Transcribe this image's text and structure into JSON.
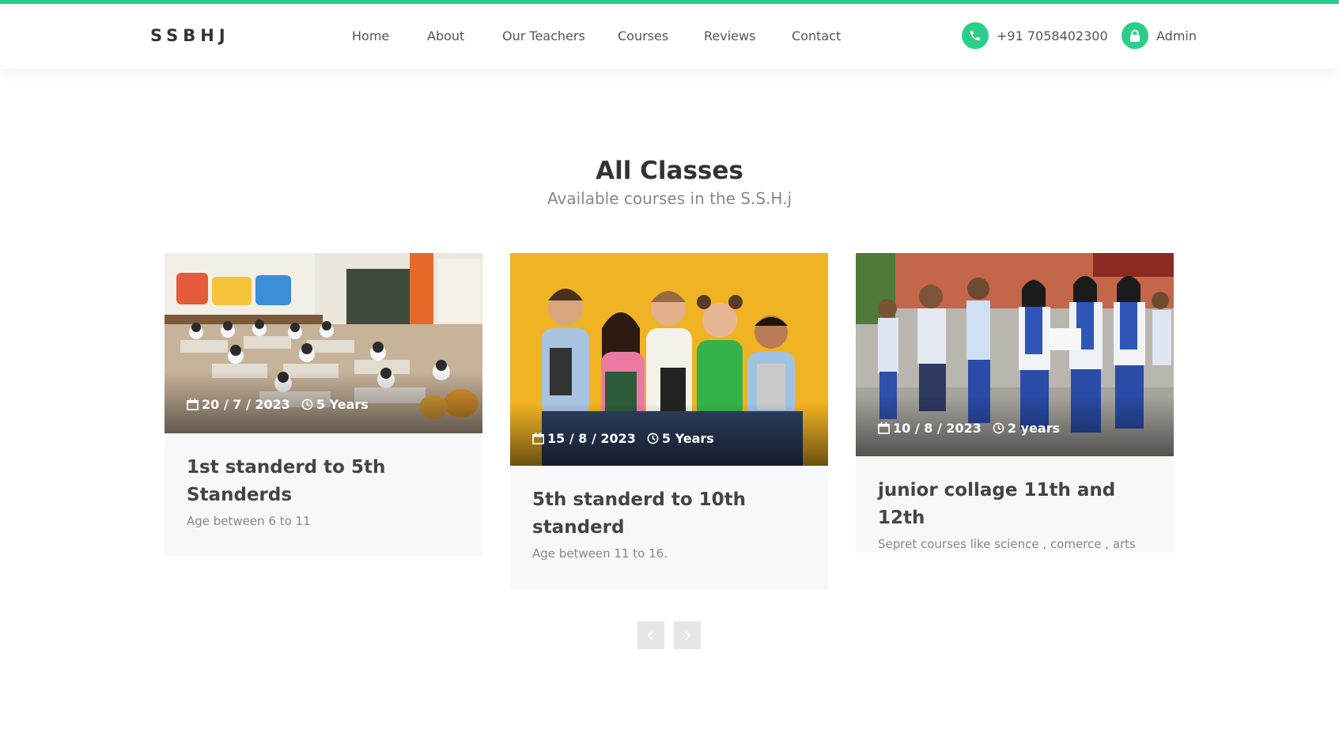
{
  "brand": "SSBHJ",
  "nav": {
    "items": [
      {
        "label": "Home"
      },
      {
        "label": "About"
      },
      {
        "label": "Our Teachers"
      },
      {
        "label": "Courses"
      },
      {
        "label": "Reviews"
      },
      {
        "label": "Contact"
      }
    ],
    "phone": "+91 7058402300",
    "admin": "Admin"
  },
  "section": {
    "title": "All Classes",
    "subtitle": "Available courses in the S.S.H.j"
  },
  "cards": [
    {
      "date": "20 / 7 / 2023",
      "duration": "5 Years",
      "title": "1st standerd to 5th Standerds",
      "desc": "Age between 6 to 11",
      "image": "classroom-photo"
    },
    {
      "date": "15 / 8 / 2023",
      "duration": "5 Years",
      "title": "5th standerd to 10th standerd",
      "desc": "Age between 11 to 16.",
      "image": "students-yellow-background-photo"
    },
    {
      "date": "10 / 8 / 2023",
      "duration": "2 years",
      "title": "junior collage 11th and 12th",
      "desc": "Sepret courses like science , comerce , arts",
      "image": "college-students-photo"
    }
  ],
  "colors": {
    "accent": "#2ccf8a",
    "heading": "#333333",
    "muted": "#888888",
    "card_bg": "#f8f8f8"
  },
  "icons": [
    "phone-icon",
    "lock-icon",
    "calendar-icon",
    "clock-icon",
    "chevron-left-icon",
    "chevron-right-icon"
  ]
}
